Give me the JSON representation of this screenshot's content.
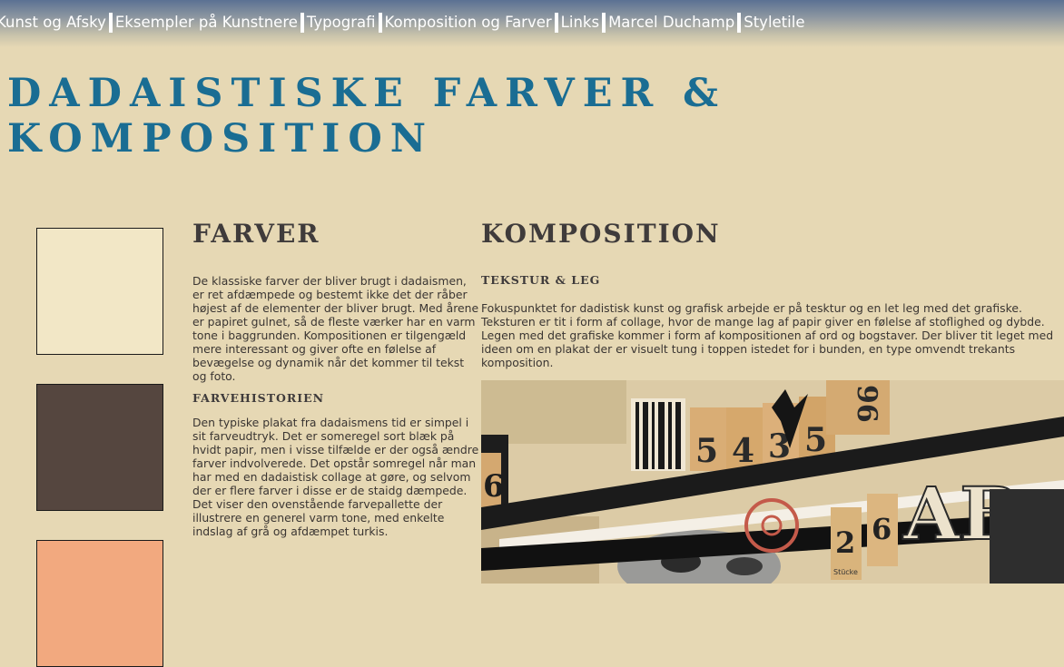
{
  "nav": {
    "items": [
      {
        "label": "Kunst og Afsky"
      },
      {
        "label": "Eksempler på Kunstnere"
      },
      {
        "label": "Typografi"
      },
      {
        "label": "Komposition og Farver"
      },
      {
        "label": "Links"
      },
      {
        "label": "Marcel Duchamp"
      },
      {
        "label": "Styletile"
      }
    ]
  },
  "page": {
    "title": "Dadaistiske Farver & Komposition"
  },
  "palette": {
    "swatches": [
      {
        "color": "#f2e7c6"
      },
      {
        "color": "#55463f"
      },
      {
        "color": "#f2a97f"
      }
    ]
  },
  "farver": {
    "heading": "Farver",
    "intro": "De klassiske farver der bliver brugt i dadaismen, er ret afdæmpede og bestemt ikke det der råber højest af de elementer der bliver brugt. Med årene er papiret gulnet, så de fleste værker har en varm tone i baggrunden. Kompositionen er tilgengæld mere interessant og giver ofte en følelse af bevægelse og dynamik når det kommer til tekst og foto.",
    "subheading": "Farvehistorien",
    "history": "Den typiske plakat fra dadaismens tid er simpel i sit farveudtryk. Det er someregel sort blæk på hvidt papir, men i visse tilfælde er der også ændre farver indvolverede. Det opstår somregel når man har med en dadaistisk collage at gøre, og selvom der er flere farver i disse er de staidg dæmpede. Det viser den ovenstående farvepallette der illustrere en generel varm tone, med enkelte indslag af grå og afdæmpet turkis."
  },
  "komposition": {
    "heading": "Komposition",
    "subheading": "Tekstur & leg",
    "body": "Fokuspunktet for dadistisk kunst og grafisk arbejde er på tesktur og en let leg med det grafiske. Teksturen er tit i form af collage, hvor de mange lag af papir giver en følelse af stoflighed og dybde. Legen med det grafiske kommer i form af kompositionen af ord og bogstaver. Der bliver tit leget med ideen om en plakat der er visuelt tung i toppen istedet for i bunden, en type omvendt trekants komposition."
  },
  "collage": {
    "numbers": [
      "6",
      "5",
      "4",
      "3",
      "5",
      "2",
      "6",
      "96"
    ],
    "letters": "AB",
    "stamp": "Stücke"
  }
}
